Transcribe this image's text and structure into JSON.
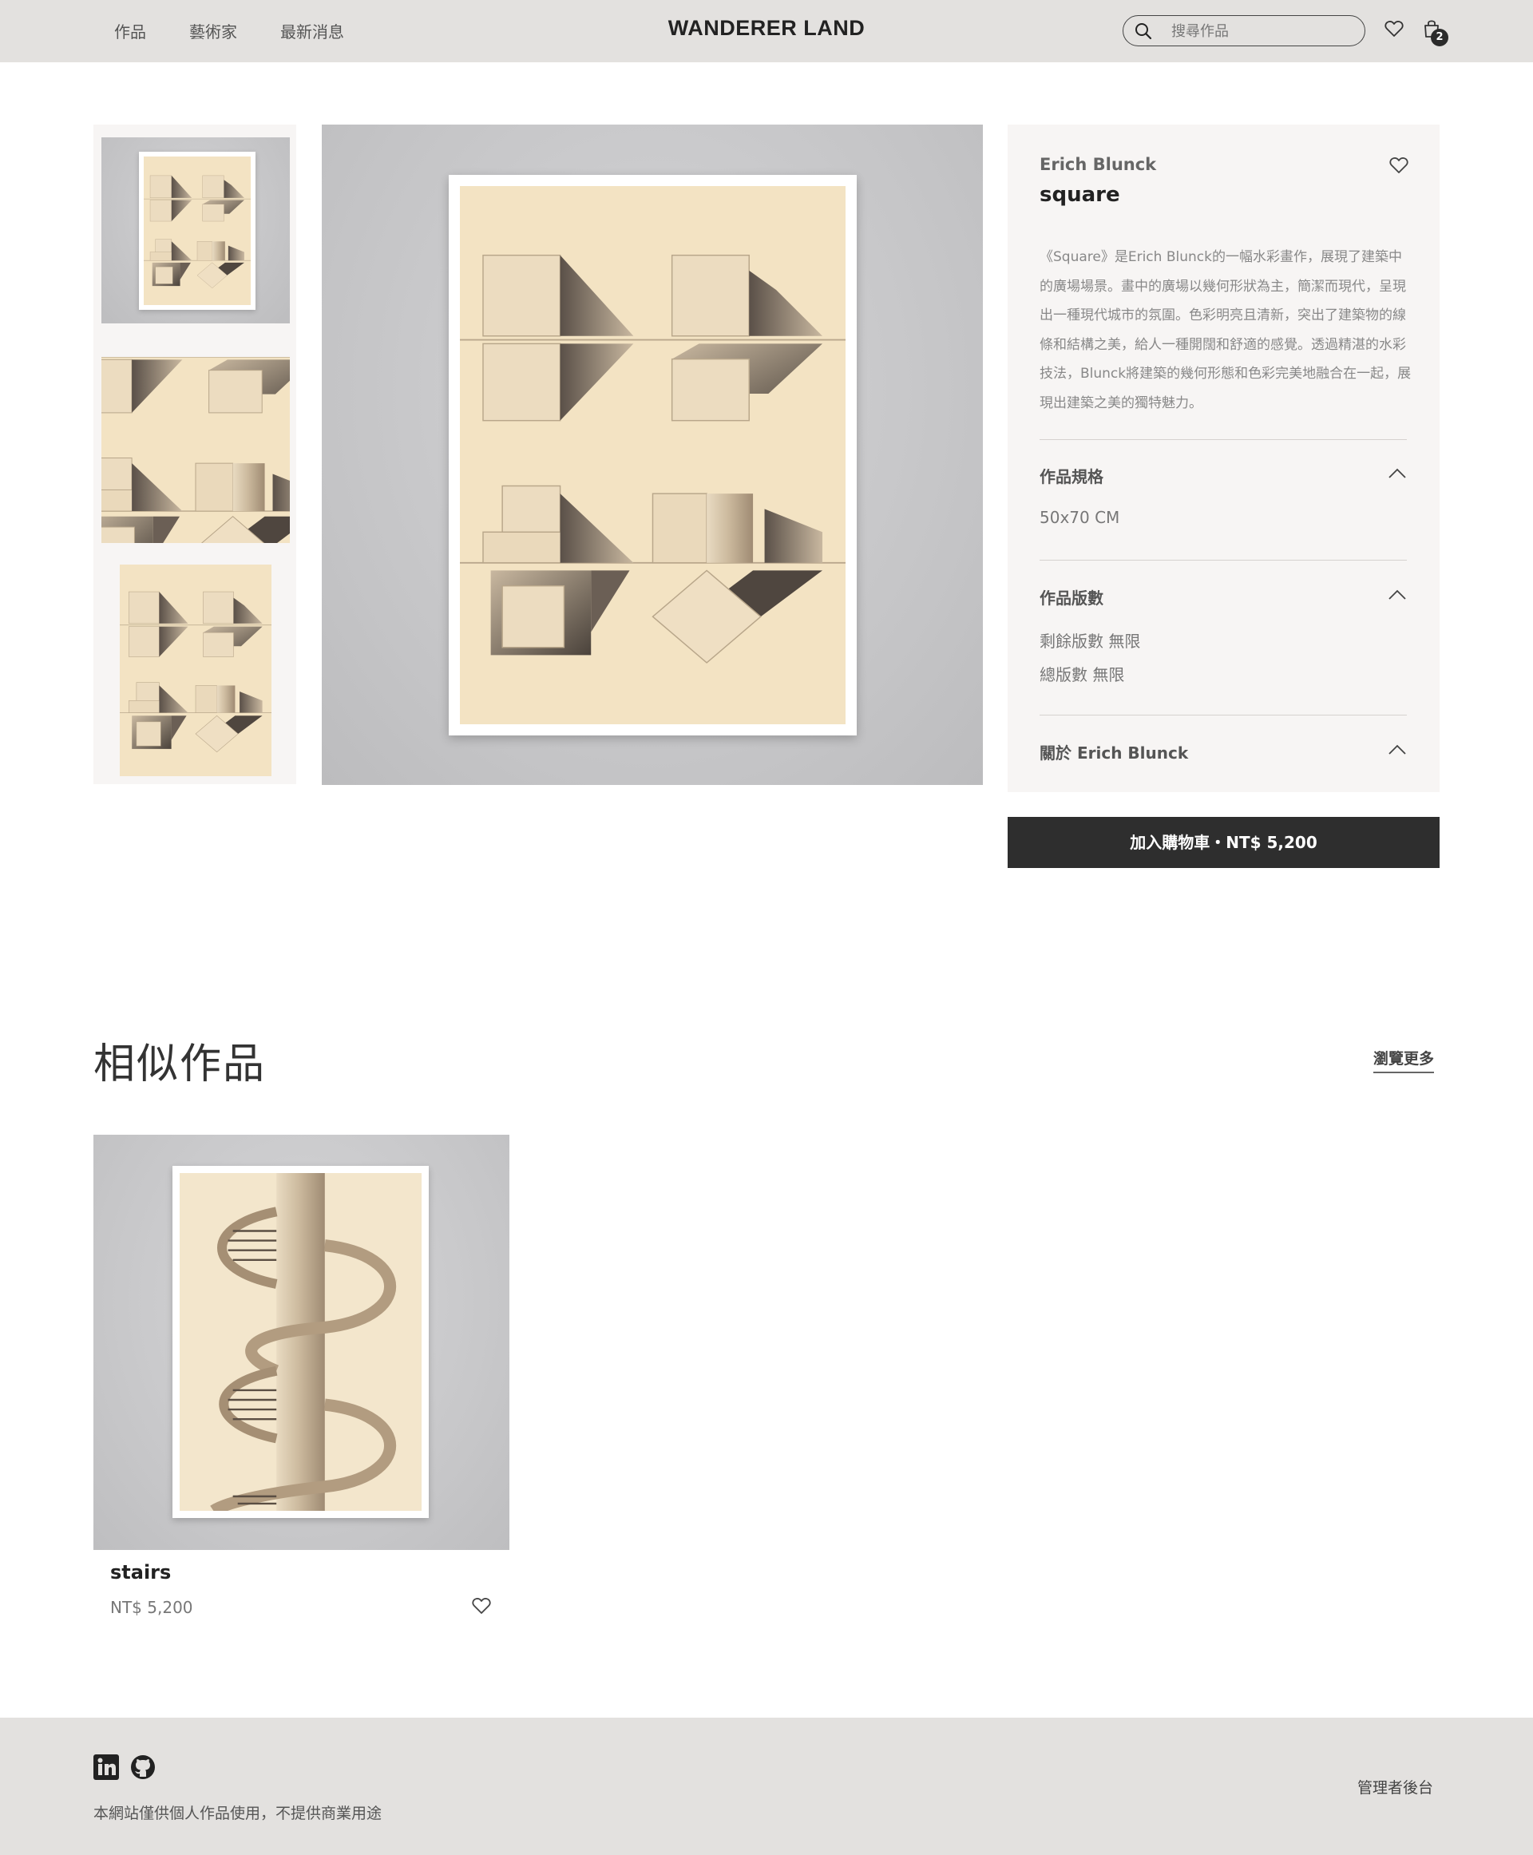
{
  "header": {
    "nav": [
      "作品",
      "藝術家",
      "最新消息"
    ],
    "brand": "WANDERER LAND",
    "search_placeholder": "搜尋作品",
    "cart_count": "2"
  },
  "product": {
    "artist": "Erich Blunck",
    "title": "square",
    "description": "《Square》是Erich Blunck的一幅水彩畫作，展現了建築中的廣場場景。畫中的廣場以幾何形狀為主，簡潔而現代，呈現出一種現代城市的氛圍。色彩明亮且清新，突出了建築物的線條和結構之美，給人一種開闊和舒適的感覺。透過精湛的水彩技法，Blunck將建築的幾何形態和色彩完美地融合在一起，展現出建築之美的獨特魅力。",
    "spec_title": "作品規格",
    "spec_value": "50x70 CM",
    "edition_title": "作品版數",
    "edition_remaining": "剩餘版數 無限",
    "edition_total": "總版數 無限",
    "about_title": "關於 Erich Blunck",
    "add_to_cart": "加入購物車・NT$ 5,200"
  },
  "similar": {
    "heading": "相似作品",
    "more": "瀏覽更多",
    "items": [
      {
        "title": "stairs",
        "price": "NT$ 5,200"
      }
    ]
  },
  "footer": {
    "note": "本網站僅供個人作品使用，不提供商業用途",
    "admin": "管理者後台"
  },
  "icons": [
    "search-icon",
    "heart-icon",
    "shopping-bag-icon",
    "chevron-up-icon",
    "linkedin-icon",
    "github-icon"
  ],
  "colors": {
    "header_bg": "#e3e1df",
    "panel_bg": "#f7f5f4",
    "button_bg": "#2e2e2e",
    "paper": "#f3e3c3"
  }
}
